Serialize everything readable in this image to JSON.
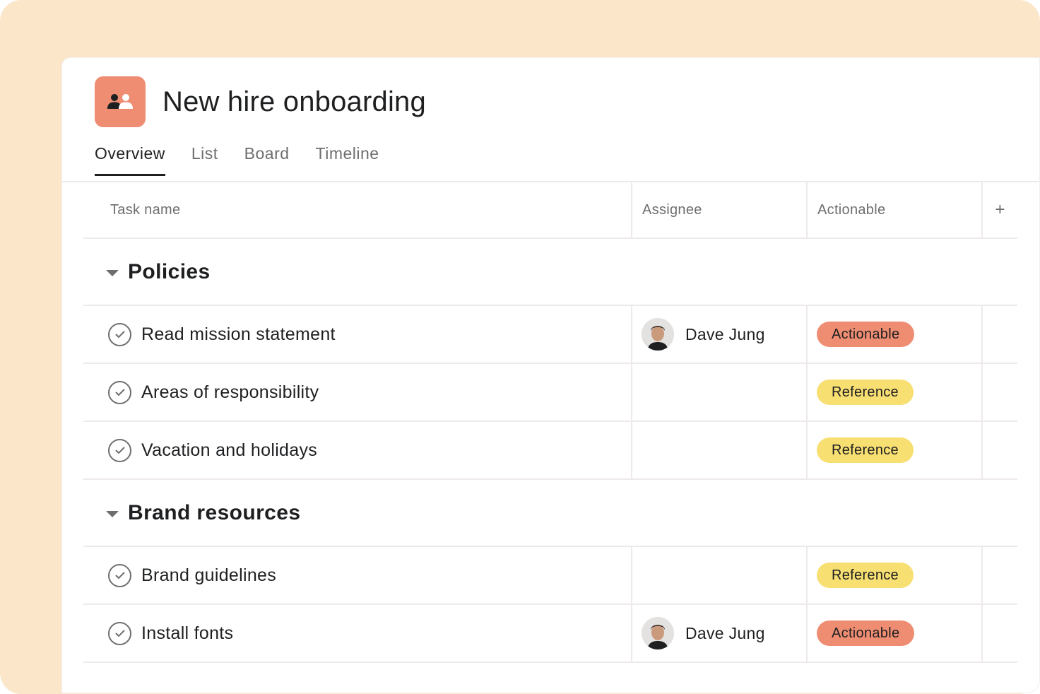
{
  "project": {
    "title": "New hire onboarding",
    "icon": "people-icon",
    "icon_color": "#ef8d72"
  },
  "tabs": [
    {
      "label": "Overview",
      "active": true
    },
    {
      "label": "List",
      "active": false
    },
    {
      "label": "Board",
      "active": false
    },
    {
      "label": "Timeline",
      "active": false
    }
  ],
  "table": {
    "columns": {
      "task_name": "Task name",
      "assignee": "Assignee",
      "actionable": "Actionable",
      "add": "+"
    },
    "sections": [
      {
        "title": "Policies",
        "tasks": [
          {
            "name": "Read mission statement",
            "assignee": "Dave Jung",
            "tag": "Actionable",
            "tag_type": "actionable"
          },
          {
            "name": "Areas of responsibility",
            "assignee": "",
            "tag": "Reference",
            "tag_type": "reference"
          },
          {
            "name": "Vacation and holidays",
            "assignee": "",
            "tag": "Reference",
            "tag_type": "reference"
          }
        ]
      },
      {
        "title": "Brand resources",
        "tasks": [
          {
            "name": "Brand guidelines",
            "assignee": "",
            "tag": "Reference",
            "tag_type": "reference"
          },
          {
            "name": "Install fonts",
            "assignee": "Dave Jung",
            "tag": "Actionable",
            "tag_type": "actionable"
          }
        ]
      }
    ]
  },
  "colors": {
    "background": "#fce6c9",
    "actionable": "#ef8d72",
    "reference": "#f8df72"
  }
}
